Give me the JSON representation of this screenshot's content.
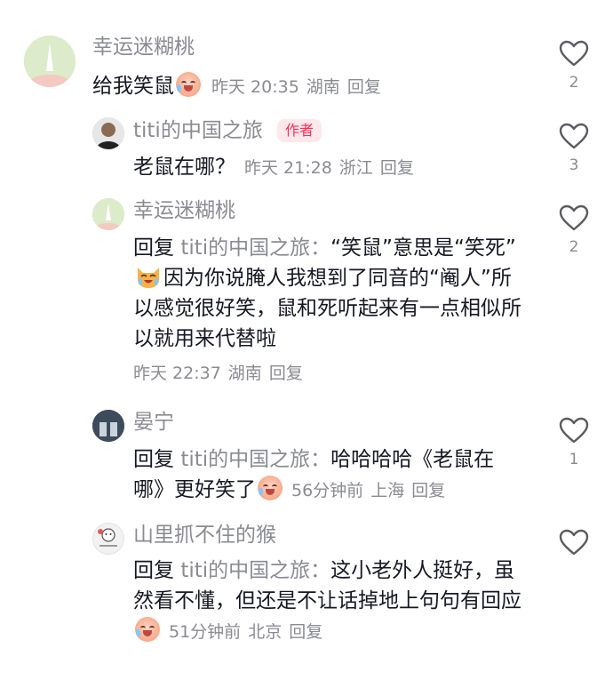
{
  "comments": [
    {
      "name": "幸运迷糊桃",
      "text": "给我笑鼠",
      "time": "昨天 20:35",
      "location": "湖南",
      "reply_label": "回复",
      "likes": "2"
    },
    {
      "name": "titi的中国之旅",
      "badge": "作者",
      "text": "老鼠在哪？",
      "time": "昨天 21:28",
      "location": "浙江",
      "reply_label": "回复",
      "likes": "3"
    },
    {
      "name": "幸运迷糊桃",
      "reply_prefix": "回复",
      "reply_target": "titi的中国之旅：",
      "text_a": "“笑鼠”意思是“笑死”",
      "text_b": "因为你说腌人我想到了同音的“阉人”所以感觉很好笑，鼠和死听起来有一点相似所以就用来代替啦",
      "time": "昨天 22:37",
      "location": "湖南",
      "reply_label": "回复",
      "likes": "2"
    },
    {
      "name": "晏宁",
      "reply_prefix": "回复",
      "reply_target": "titi的中国之旅：",
      "text": "哈哈哈哈《老鼠在哪》更好笑了",
      "time": "56分钟前",
      "location": "上海",
      "reply_label": "回复",
      "likes": "1"
    },
    {
      "name": "山里抓不住的猴",
      "reply_prefix": "回复",
      "reply_target": "titi的中国之旅：",
      "text": "这小老外人挺好，虽然看不懂，但还是不让话掉地上句句有回应",
      "time": "51分钟前",
      "location": "北京",
      "reply_label": "回复",
      "likes": null
    }
  ],
  "icons": {
    "like": "heart-outline-icon",
    "emoji_cry_laugh": "crying-laugh-emoji",
    "emoji_cat": "crying-cat-emoji"
  },
  "colors": {
    "name_gray": "#8a8b91",
    "text": "#161823",
    "author_badge": "#fe2c55",
    "author_badge_bg": "#fde8ec"
  }
}
